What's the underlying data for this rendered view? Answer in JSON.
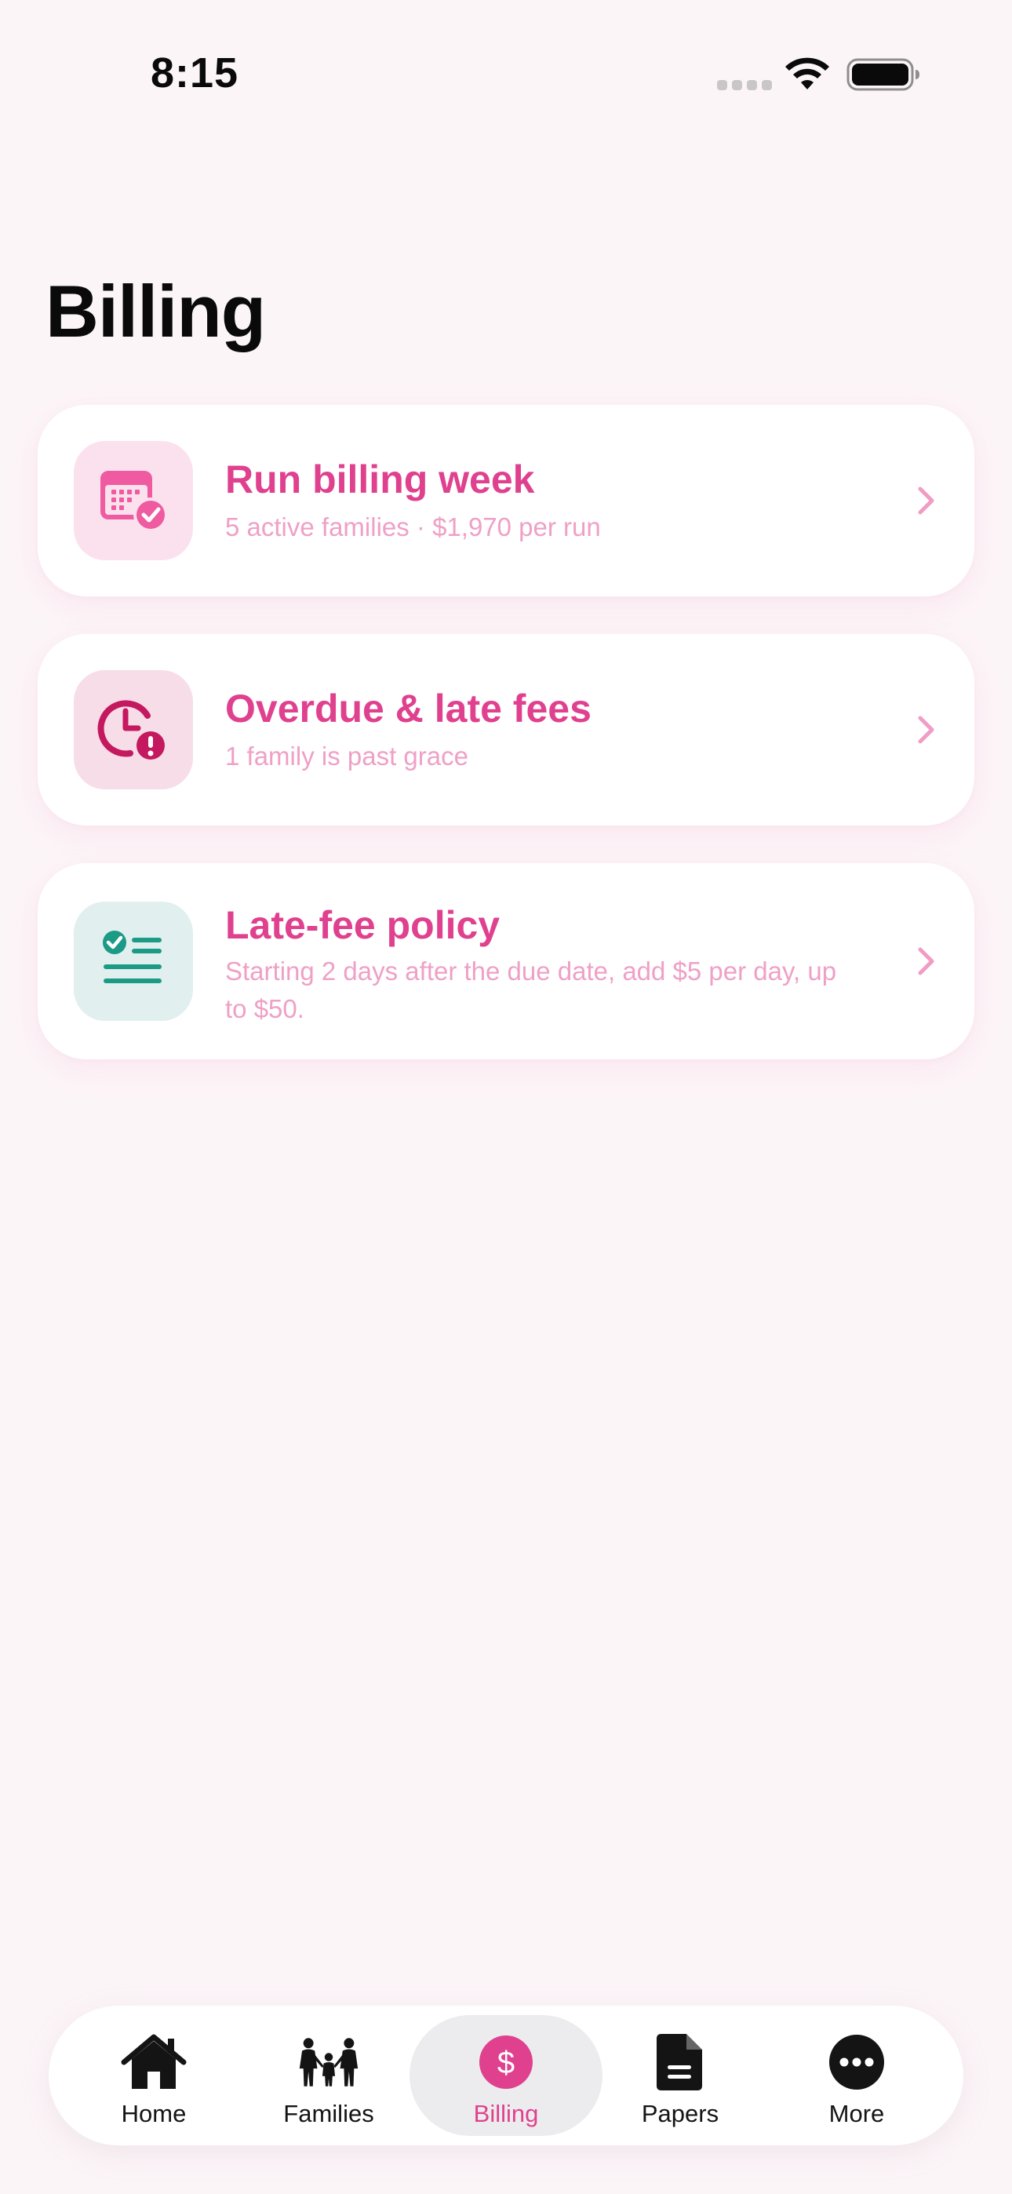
{
  "status_bar": {
    "time": "8:15"
  },
  "page": {
    "title": "Billing"
  },
  "colors": {
    "accent": "#e0418f",
    "subtext": "#efa0c6",
    "background": "#fcf5f8",
    "teal": "#1b9a86"
  },
  "cards": [
    {
      "icon": "calendar-check-icon",
      "title": "Run billing week",
      "subtitle": "5 active families · $1,970 per run"
    },
    {
      "icon": "clock-alert-icon",
      "title": "Overdue & late fees",
      "subtitle": "1 family is past grace"
    },
    {
      "icon": "policy-list-icon",
      "title": "Late-fee policy",
      "subtitle": "Starting 2 days after the due date, add $5 per day, up to $50."
    }
  ],
  "tab_bar": {
    "items": [
      {
        "label": "Home",
        "icon": "home-icon"
      },
      {
        "label": "Families",
        "icon": "family-icon"
      },
      {
        "label": "Billing",
        "icon": "dollar-icon",
        "selected": true
      },
      {
        "label": "Papers",
        "icon": "document-icon"
      },
      {
        "label": "More",
        "icon": "ellipsis-icon"
      }
    ]
  }
}
